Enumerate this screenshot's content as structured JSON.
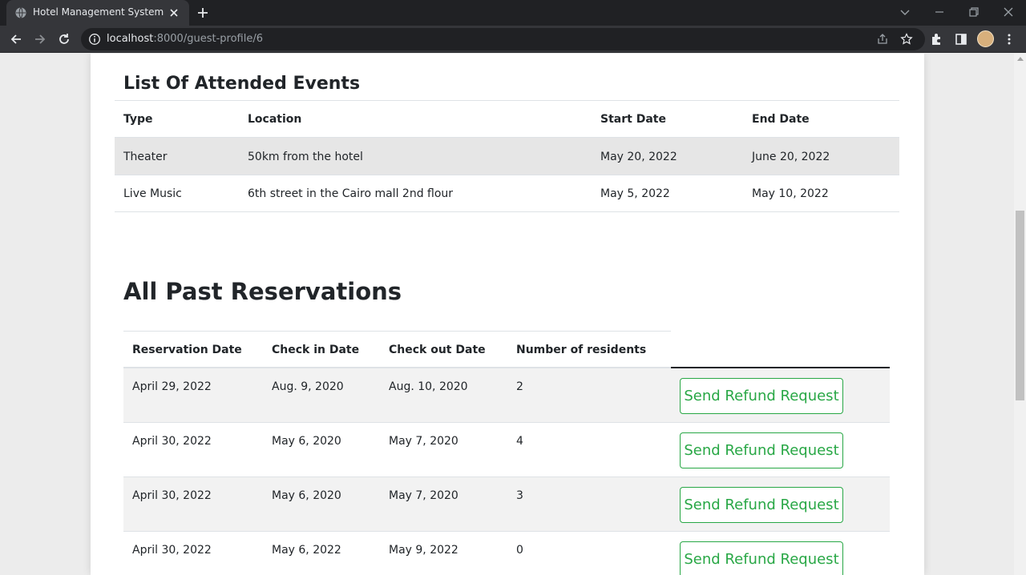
{
  "browser": {
    "tab_title": "Hotel Management System",
    "url_host": "localhost",
    "url_rest": ":8000/guest-profile/6"
  },
  "events": {
    "title": "List Of Attended Events",
    "columns": [
      "Type",
      "Location",
      "Start Date",
      "End Date"
    ],
    "rows": [
      [
        "Theater",
        "50km from the hotel",
        "May 20, 2022",
        "June 20, 2022"
      ],
      [
        "Live Music",
        "6th street in the Cairo mall 2nd flour",
        "May 5, 2022",
        "May 10, 2022"
      ]
    ]
  },
  "reservations": {
    "title": "All Past Reservations",
    "columns": [
      "Reservation Date",
      "Check in Date",
      "Check out Date",
      "Number of residents"
    ],
    "refund_label": "Send Refund Request",
    "rows": [
      [
        "April 29, 2022",
        "Aug. 9, 2020",
        "Aug. 10, 2020",
        "2"
      ],
      [
        "April 30, 2022",
        "May 6, 2020",
        "May 7, 2020",
        "4"
      ],
      [
        "April 30, 2022",
        "May 6, 2020",
        "May 7, 2020",
        "3"
      ],
      [
        "April 30, 2022",
        "May 6, 2022",
        "May 9, 2022",
        "0"
      ]
    ]
  },
  "colors": {
    "chrome_dark": "#202124",
    "chrome_tab": "#35363a",
    "accent_green": "#28a745",
    "stripe": "#f2f2f2"
  }
}
